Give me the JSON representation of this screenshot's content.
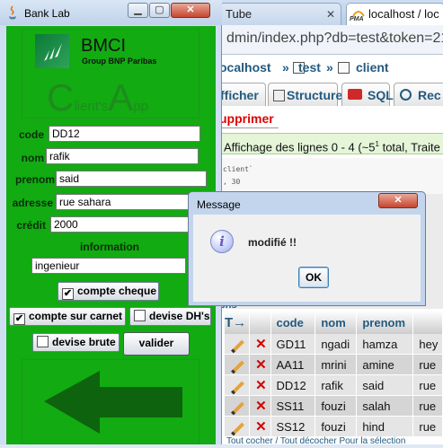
{
  "browser": {
    "tabs": [
      {
        "label": "Tube",
        "close": "✕"
      },
      {
        "label": "localhost / loc",
        "icon_text": "PMA"
      }
    ],
    "url_fragment": "dmin/index.php?db=test&token=21",
    "breadcrumb": {
      "server": "ocalhost",
      "sep1": "»",
      "db": "test",
      "sep2": "»",
      "table": "client"
    },
    "pma_tabs": [
      "fficher",
      "Structure",
      "SQL",
      "Rec"
    ],
    "supprimer": "upprimer",
    "affichage": "Affichage des lignes 0 - 4 (~5",
    "affichage_sup": "1",
    "affichage_rest": " total, Traite",
    "code_lines": [
      "client`",
      ", 30"
    ],
    "options_label": "ons",
    "table": {
      "arrow": "T→",
      "headers": [
        "code",
        "nom",
        "prenom"
      ],
      "extra_header": "",
      "rows": [
        {
          "code": "GD11",
          "nom": "ngadi",
          "prenom": "hamza",
          "extra": "hey"
        },
        {
          "code": "AA11",
          "nom": "mrini",
          "prenom": "amine",
          "extra": "rue"
        },
        {
          "code": "DD12",
          "nom": "rafik",
          "prenom": "said",
          "extra": "rue"
        },
        {
          "code": "SS11",
          "nom": "fouzi",
          "prenom": "salah",
          "extra": "rue"
        },
        {
          "code": "SS12",
          "nom": "fouzi",
          "prenom": "hind",
          "extra": "rue"
        }
      ]
    },
    "bottom_text": "Tout cocher / Tout décocher   Pour la sélection"
  },
  "bank": {
    "title": "Bank Lab",
    "window_buttons": {
      "min": "▁",
      "max": "▢",
      "close": "✕"
    },
    "logo_title": "BMCI",
    "logo_subtitle": "Group BNP Paribas",
    "client_app": {
      "c": "C",
      "lient": "lient's",
      "a": "A",
      "pp": "pp"
    },
    "fields": {
      "code": {
        "label": "code",
        "value": "DD12"
      },
      "nom": {
        "label": "nom",
        "value": "rafik"
      },
      "prenom": {
        "label": "prenom",
        "value": "said"
      },
      "adresse": {
        "label": "adresse",
        "value": "rue sahara"
      },
      "credit": {
        "label": "crédit",
        "value": "2000"
      }
    },
    "information_label": "information",
    "information_value": "ingenieur",
    "checks": {
      "compte_cheque": {
        "label": "compte cheque",
        "checked": true
      },
      "compte_carnet": {
        "label": "compte sur carnet",
        "checked": true
      },
      "devise_dh": {
        "label": "devise DH's",
        "checked": false
      },
      "devise_brute": {
        "label": "devise brute",
        "checked": false
      }
    },
    "valider_label": "valider",
    "colors": {
      "panel_green": "#12ab12",
      "arrow_green": "#0e630e"
    }
  },
  "dialog": {
    "title": "Message",
    "close": "✕",
    "icon_letter": "i",
    "message": "modifié !!",
    "ok_label": "OK"
  }
}
